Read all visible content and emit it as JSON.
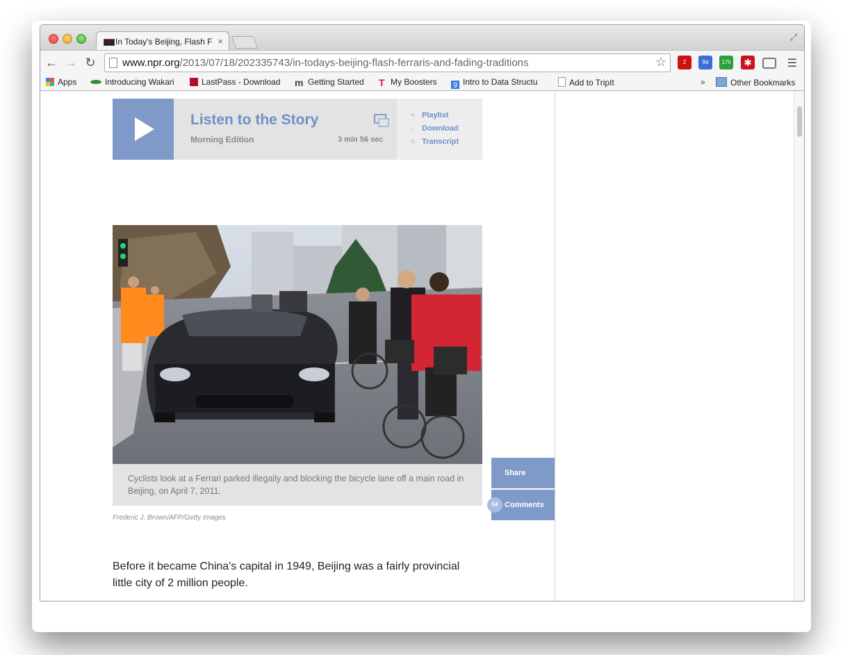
{
  "browser": {
    "tab_title": "In Today's Beijing, Flash Fe",
    "url_domain": "www.npr.org",
    "url_path": "/2013/07/18/202335743/in-todays-beijing-flash-ferraris-and-fading-traditions",
    "extensions": [
      {
        "icon": "adblock-icon",
        "badge": "2",
        "color": "#cc1111"
      },
      {
        "icon": "calendar-icon",
        "badge": "9d",
        "color": "#3a6fd8"
      },
      {
        "icon": "tracker-icon",
        "badge": "17h",
        "color": "#2e9e3e"
      },
      {
        "icon": "lastpass-icon",
        "badge": "",
        "color": "#cc1122"
      }
    ],
    "bookmarks": [
      {
        "label": "Apps",
        "icon": "apps-grid-icon"
      },
      {
        "label": "Introducing Wakari",
        "icon": "wakari-icon"
      },
      {
        "label": "LastPass - Download",
        "icon": "lastpass-icon"
      },
      {
        "label": "Getting Started",
        "icon": "mendeley-icon"
      },
      {
        "label": "My Boosters",
        "icon": "tmobile-icon"
      },
      {
        "label": "Intro to Data Structu",
        "icon": "google-icon"
      },
      {
        "label": "Add to TripIt",
        "icon": "page-icon"
      }
    ],
    "overflow_chevron": "»",
    "other_bookmarks": "Other Bookmarks"
  },
  "player": {
    "title": "Listen to the Story",
    "program": "Morning Edition",
    "duration": "3 min 56 sec",
    "links": [
      {
        "label": "Playlist",
        "icon": "+"
      },
      {
        "label": "Download",
        "icon": "↓"
      },
      {
        "label": "Transcript",
        "icon": "≡"
      }
    ]
  },
  "photo": {
    "caption": "Cyclists look at a Ferrari parked illegally and blocking the bicycle lane off a main road in Beijing, on April 7, 2011.",
    "credit": "Frederic J. Brown/AFP/Getty Images"
  },
  "social": {
    "share_label": "Share",
    "comments_label": "Comments",
    "comments_count": "54"
  },
  "article": {
    "paragraph": "Before it became China's capital in 1949, Beijing was a fairly provincial little city of 2 million people."
  }
}
